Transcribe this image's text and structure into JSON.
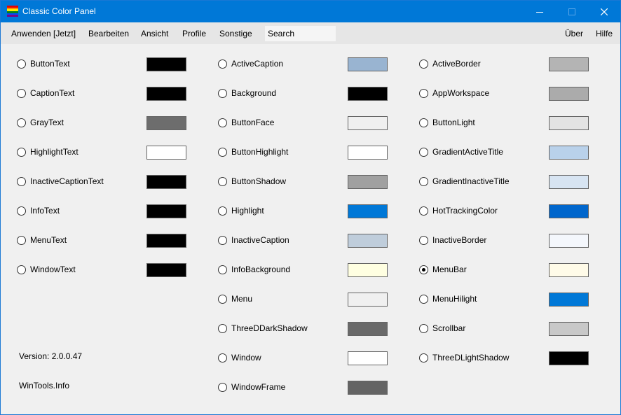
{
  "window": {
    "title": "Classic Color Panel"
  },
  "menu": {
    "items": [
      "Anwenden [Jetzt]",
      "Bearbeiten",
      "Ansicht",
      "Profile",
      "Sonstige"
    ],
    "search_placeholder": "Search",
    "right_items": [
      "Über",
      "Hilfe"
    ]
  },
  "columns": [
    [
      {
        "label": "ButtonText",
        "color": "#000000",
        "selected": false
      },
      {
        "label": "CaptionText",
        "color": "#000000",
        "selected": false
      },
      {
        "label": "GrayText",
        "color": "#6d6d6d",
        "selected": false
      },
      {
        "label": "HighlightText",
        "color": "#ffffff",
        "selected": false
      },
      {
        "label": "InactiveCaptionText",
        "color": "#000000",
        "selected": false
      },
      {
        "label": "InfoText",
        "color": "#000000",
        "selected": false
      },
      {
        "label": "MenuText",
        "color": "#000000",
        "selected": false
      },
      {
        "label": "WindowText",
        "color": "#000000",
        "selected": false
      }
    ],
    [
      {
        "label": "ActiveCaption",
        "color": "#99b4d1",
        "selected": false
      },
      {
        "label": "Background",
        "color": "#000000",
        "selected": false
      },
      {
        "label": "ButtonFace",
        "color": "#f0f0f0",
        "selected": false
      },
      {
        "label": "ButtonHighlight",
        "color": "#ffffff",
        "selected": false
      },
      {
        "label": "ButtonShadow",
        "color": "#a0a0a0",
        "selected": false
      },
      {
        "label": "Highlight",
        "color": "#0078d7",
        "selected": false
      },
      {
        "label": "InactiveCaption",
        "color": "#bfcddb",
        "selected": false
      },
      {
        "label": "InfoBackground",
        "color": "#ffffe1",
        "selected": false
      },
      {
        "label": "Menu",
        "color": "#f0f0f0",
        "selected": false
      },
      {
        "label": "ThreeDDarkShadow",
        "color": "#696969",
        "selected": false
      },
      {
        "label": "Window",
        "color": "#ffffff",
        "selected": false
      },
      {
        "label": "WindowFrame",
        "color": "#646464",
        "selected": false
      }
    ],
    [
      {
        "label": "ActiveBorder",
        "color": "#b4b4b4",
        "selected": false
      },
      {
        "label": "AppWorkspace",
        "color": "#ababab",
        "selected": false
      },
      {
        "label": "ButtonLight",
        "color": "#e3e3e3",
        "selected": false
      },
      {
        "label": "GradientActiveTitle",
        "color": "#b9d1ea",
        "selected": false
      },
      {
        "label": "GradientInactiveTitle",
        "color": "#d7e4f2",
        "selected": false
      },
      {
        "label": "HotTrackingColor",
        "color": "#0066cc",
        "selected": false
      },
      {
        "label": "InactiveBorder",
        "color": "#f4f7fc",
        "selected": false
      },
      {
        "label": "MenuBar",
        "color": "#fffbe8",
        "selected": true
      },
      {
        "label": "MenuHilight",
        "color": "#0078d7",
        "selected": false
      },
      {
        "label": "Scrollbar",
        "color": "#c8c8c8",
        "selected": false
      },
      {
        "label": "ThreeDLightShadow",
        "color": "#000000",
        "selected": false
      }
    ]
  ],
  "footer": {
    "version": "Version: 2.0.0.47",
    "site": "WinTools.Info"
  }
}
